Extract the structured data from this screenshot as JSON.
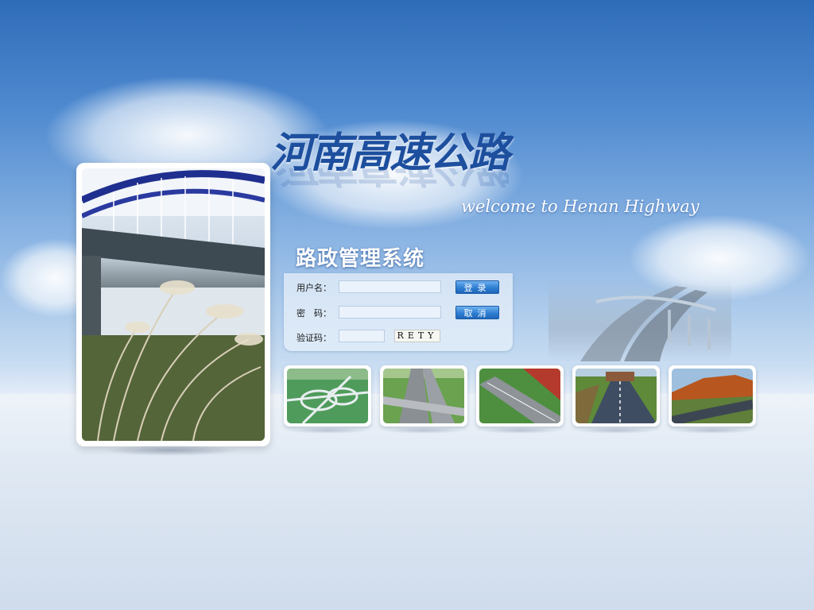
{
  "header": {
    "logo_text": "河南高速公路",
    "welcome": "welcome to Henan Highway"
  },
  "login": {
    "system_title": "路政管理系统",
    "username_label": "用户名：",
    "password_label": "密　码：",
    "captcha_label": "验证码：",
    "username_value": "",
    "password_value": "",
    "captcha_input_value": "",
    "captcha_code": "RETY",
    "login_button": "登录",
    "cancel_button": "取消"
  },
  "thumbnails": [
    {
      "name": "interchange-photo-1"
    },
    {
      "name": "highway-overpass-photo"
    },
    {
      "name": "highway-greenbelt-photo"
    },
    {
      "name": "tunnel-highway-photo"
    },
    {
      "name": "mountain-highway-photo"
    }
  ],
  "colors": {
    "sky_top": "#2f6cb8",
    "button_blue": "#2f7fd3",
    "title_blue": "#1d4f9e"
  }
}
